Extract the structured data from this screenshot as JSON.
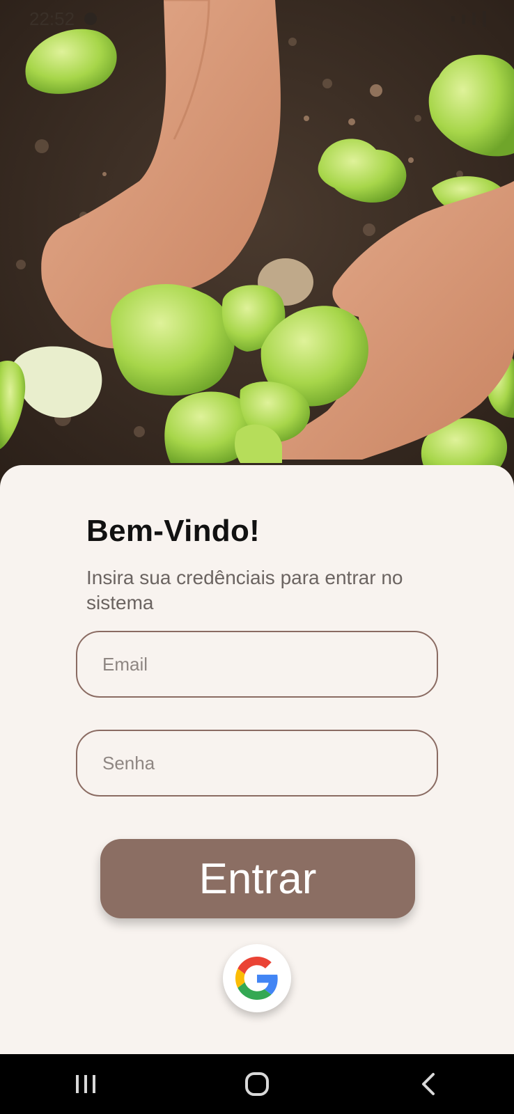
{
  "status_bar": {
    "time": "22:52"
  },
  "login": {
    "title": "Bem-Vindo!",
    "subtitle": "Insira sua credênciais para entrar no sistema",
    "email_placeholder": "Email",
    "password_placeholder": "Senha",
    "submit_label": "Entrar"
  },
  "icons": {
    "google": "google-logo-icon",
    "recent_apps": "recent-apps-icon",
    "home": "home-icon",
    "back": "back-icon"
  },
  "colors": {
    "sheet_background": "#f8f3ef",
    "primary_button": "#8b6e63",
    "field_border": "#8a6b62",
    "nav_bar": "#000000"
  }
}
